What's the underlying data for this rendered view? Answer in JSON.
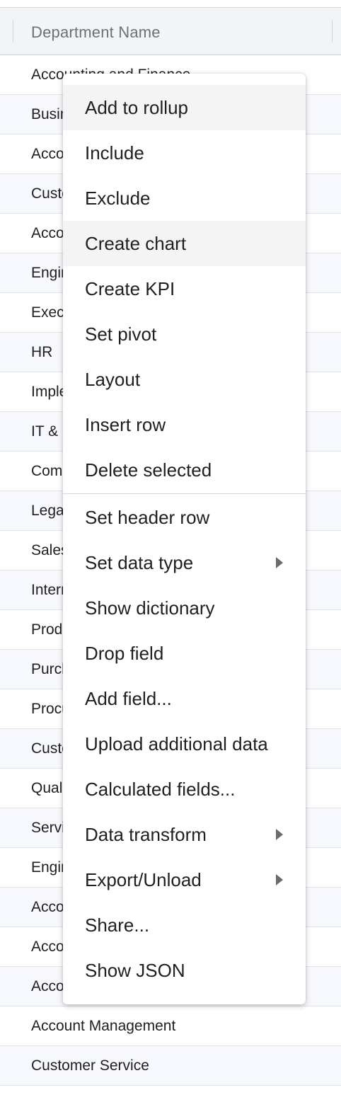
{
  "grid": {
    "header": "Department Name",
    "rows": [
      "Accounting and Finance",
      "Business",
      "Accounting",
      "Customer",
      "Accounting",
      "Engineering",
      "Executive",
      "HR",
      "Implementation",
      "IT & Security",
      "Compliance",
      "Legal",
      "Sales",
      "Internal",
      "Product",
      "Purchasing",
      "Procurement",
      "Customer",
      "Quality",
      "Services",
      "Engineering",
      "Accounting",
      "Accounting",
      "Accounting",
      "Account Management",
      "Customer Service"
    ]
  },
  "context_menu": {
    "group1": [
      {
        "label": "Add to rollup",
        "highlight": true
      },
      {
        "label": "Include"
      },
      {
        "label": "Exclude"
      },
      {
        "label": "Create chart",
        "highlight": true
      },
      {
        "label": "Create KPI"
      },
      {
        "label": "Set pivot"
      },
      {
        "label": "Layout"
      },
      {
        "label": "Insert row"
      },
      {
        "label": "Delete selected"
      }
    ],
    "group2": [
      {
        "label": "Set header row"
      },
      {
        "label": "Set data type",
        "submenu": true
      },
      {
        "label": "Show dictionary"
      },
      {
        "label": "Drop field"
      },
      {
        "label": "Add field..."
      },
      {
        "label": "Upload additional data"
      },
      {
        "label": "Calculated fields..."
      },
      {
        "label": "Data transform",
        "submenu": true
      },
      {
        "label": "Export/Unload",
        "submenu": true
      },
      {
        "label": "Share..."
      },
      {
        "label": "Show JSON"
      }
    ]
  }
}
